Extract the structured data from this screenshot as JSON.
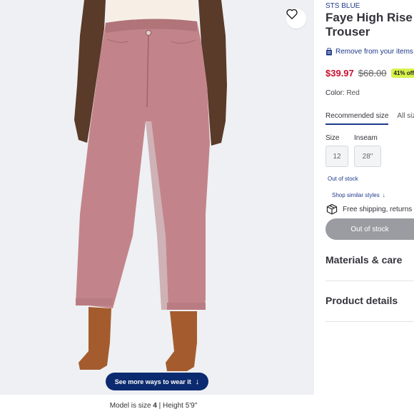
{
  "image": {
    "ways_button_label": "See more ways to wear it",
    "ways_button_arrow": "↓",
    "model_caption_prefix": "Model is size ",
    "model_size": "4",
    "model_caption_suffix": " | Height 5'9\""
  },
  "product": {
    "brand": "STS BLUE",
    "title_line1": "Faye High Rise W",
    "title_line2": "Trouser",
    "remove_label": "Remove from your items",
    "price_sale": "$39.97",
    "price_original": "$68.00",
    "discount": "41% off",
    "color_label": "Color: ",
    "color_value": "Red"
  },
  "size_tabs": [
    {
      "label": "Recommended size",
      "active": true
    },
    {
      "label": "All siz",
      "active": false
    }
  ],
  "size_selector": {
    "size_label": "Size",
    "inseam_label": "Inseam",
    "size_value": "12",
    "inseam_value": "28\"",
    "stock_note": "Out of stock",
    "similar_link": "Shop similar styles",
    "similar_arrow": "↓"
  },
  "shipping_text": "Free shipping, returns",
  "action_button": "Out of stock",
  "sections": {
    "materials": "Materials & care",
    "product_details": "Product details"
  },
  "colors": {
    "brand_blue": "#1e3a8a",
    "button_navy": "#0b2a6f",
    "sale_red": "#c8102e",
    "discount_badge": "#d7f24a",
    "disabled_gray": "#9a9ca1",
    "pants": "#c2848a"
  },
  "icons": [
    "heart-icon",
    "bag-icon",
    "arrow-down-icon",
    "box-icon"
  ]
}
